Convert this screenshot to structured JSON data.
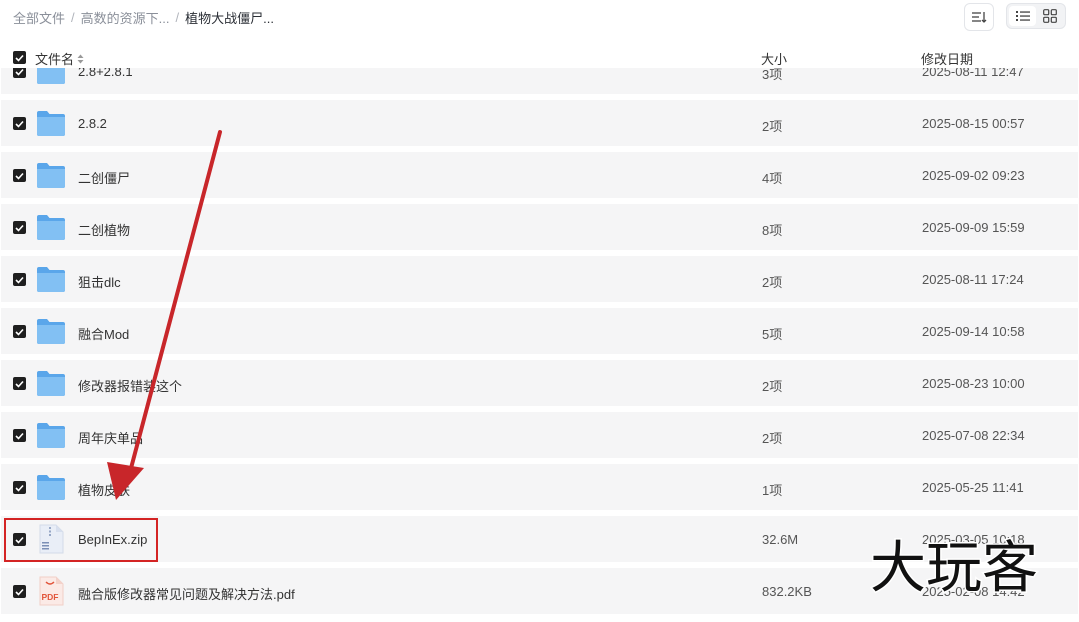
{
  "breadcrumb": {
    "items": [
      "全部文件",
      "高数的资源下...",
      "植物大战僵尸..."
    ],
    "separator": "/"
  },
  "toolbar": {
    "sort_icon": "sort-lines-icon",
    "list_view_icon": "list-view-icon",
    "grid_view_icon": "grid-view-icon",
    "active_view": "list"
  },
  "table": {
    "columns": {
      "name": "文件名",
      "size": "大小",
      "modified": "修改日期"
    },
    "sort_icon": "sort-updown-icon",
    "rows": [
      {
        "type": "folder",
        "name": "2.8+2.8.1",
        "size": "3项",
        "date": "2025-08-11 12:47"
      },
      {
        "type": "folder",
        "name": "2.8.2",
        "size": "2项",
        "date": "2025-08-15 00:57"
      },
      {
        "type": "folder",
        "name": "二创僵尸",
        "size": "4项",
        "date": "2025-09-02 09:23"
      },
      {
        "type": "folder",
        "name": "二创植物",
        "size": "8项",
        "date": "2025-09-09 15:59"
      },
      {
        "type": "folder",
        "name": "狙击dlc",
        "size": "2项",
        "date": "2025-08-11 17:24"
      },
      {
        "type": "folder",
        "name": "融合Mod",
        "size": "5项",
        "date": "2025-09-14 10:58"
      },
      {
        "type": "folder",
        "name": "修改器报错装这个",
        "size": "2项",
        "date": "2025-08-23 10:00"
      },
      {
        "type": "folder",
        "name": "周年庆单品",
        "size": "2项",
        "date": "2025-07-08 22:34"
      },
      {
        "type": "folder",
        "name": "植物皮肤",
        "size": "1项",
        "date": "2025-05-25 11:41"
      },
      {
        "type": "zip",
        "name": "BepInEx.zip",
        "size": "32.6M",
        "date": "2025-03-05 10:18"
      },
      {
        "type": "pdf",
        "name": "融合版修改器常见问题及解决方法.pdf",
        "size": "832.2KB",
        "date": "2025-02-08 14:42"
      }
    ]
  },
  "annotation": {
    "highlight_color": "#d42424",
    "arrow_color": "#c8262a"
  },
  "watermark": {
    "text": "大玩客"
  },
  "colors": {
    "row_bg": "#f5f5f6",
    "folder": "#6fb3ee",
    "checkbox": "#1f1f1f"
  }
}
